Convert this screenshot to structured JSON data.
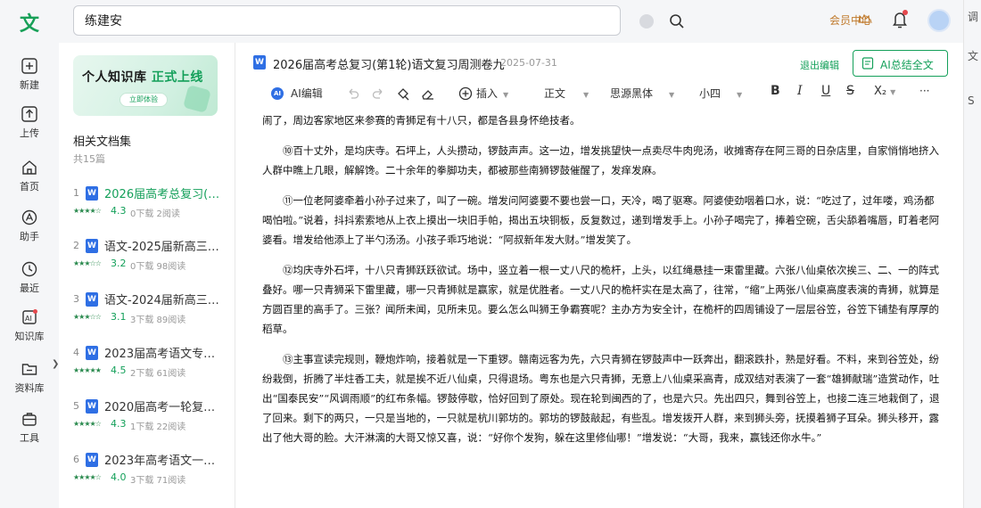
{
  "app": {
    "logo_char": "文"
  },
  "search": {
    "value": "练建安"
  },
  "header": {
    "member_center": "会员中心"
  },
  "nav": [
    {
      "label": "新建",
      "icon": "plus-icon"
    },
    {
      "label": "上传",
      "icon": "upload-icon"
    },
    {
      "label": "首页",
      "icon": "home-icon"
    },
    {
      "label": "助手",
      "icon": "assistant-icon"
    },
    {
      "label": "最近",
      "icon": "clock-icon"
    },
    {
      "label": "知识库",
      "icon": "ai-knowledge-icon"
    },
    {
      "label": "资料库",
      "icon": "folder-icon"
    },
    {
      "label": "工具",
      "icon": "toolbox-icon"
    }
  ],
  "banner": {
    "title_a": "个人知识库",
    "title_b": "正式上线",
    "button": "立即体验"
  },
  "sidebar": {
    "title": "相关文档集",
    "count": "共15篇",
    "docs": [
      {
        "num": "1",
        "name": "2026届高考总复习(…",
        "stars": "★★★★☆",
        "rating": "4.3",
        "meta": "0下载 2阅读"
      },
      {
        "num": "2",
        "name": "语文-2025届新高三…",
        "stars": "★★★☆☆",
        "rating": "3.2",
        "meta": "0下载 98阅读"
      },
      {
        "num": "3",
        "name": "语文-2024届新高三…",
        "stars": "★★★☆☆",
        "rating": "3.1",
        "meta": "3下载 89阅读"
      },
      {
        "num": "4",
        "name": "2023届高考语文专…",
        "stars": "★★★★★",
        "rating": "4.5",
        "meta": "2下载 61阅读"
      },
      {
        "num": "5",
        "name": "2020届高考一轮复…",
        "stars": "★★★★☆",
        "rating": "4.3",
        "meta": "1下载 22阅读"
      },
      {
        "num": "6",
        "name": "2023年高考语文一…",
        "stars": "★★★★☆",
        "rating": "4.0",
        "meta": "3下载 71阅读"
      }
    ]
  },
  "document": {
    "icon_char": "W",
    "title": "2026届高考总复习(第1轮)语文复习周测卷九",
    "date": "2025-07-31",
    "exit_edit": "退出编辑",
    "ai_summary": "AI总结全文"
  },
  "toolbar": {
    "ai_edit": "AI编辑",
    "insert": "插入",
    "style": "正文",
    "font": "思源黑体",
    "size": "小四",
    "bold": "B",
    "italic": "I",
    "underline": "U",
    "strike": "S",
    "sub": "X₂",
    "more": "···"
  },
  "content": {
    "p0": "闹了，周边客家地区来参赛的青狮足有十八只，都是各县身怀绝技者。",
    "p1": "⑩百十丈外，是均庆寺。石坪上，人头攒动，锣鼓声声。这一边，增发挑望快一点卖尽牛肉兜汤，收摊寄存在阿三哥的日杂店里，自家悄悄地挤入人群中瞧上几眼，解解馋。二十余年的拳脚功夫，都被那些南狮锣鼓催醒了，发痒发麻。",
    "p2": "⑪一位老阿婆牵着小孙子过来了，叫了一碗。增发问阿婆要不要也尝一口，天冷，喝了驱寒。阿婆使劲咽着口水，说：“吃过了，过年喽，鸡汤都喝怕啦。”说着，抖抖索索地从上衣上摸出一块旧手帕，揭出五块铜板，反复数过，递到增发手上。小孙子喝完了，捧着空碗，舌尖舔着嘴唇，盯着老阿婆看。增发给他添上了半勺汤汤。小孩子乖巧地说：“阿叔新年发大财。”增发笑了。",
    "p3": "⑫均庆寺外石坪，十八只青狮跃跃欲试。场中，竖立着一根一丈八尺的桅杆，上头，以红绳悬挂一束雷里藏。六张八仙桌依次挨三、二、一的阵式叠好。哪一只青狮采下雷里藏，哪一只青狮就是赢家，就是优胜者。一丈八尺的桅杆实在是太高了，往常，“缩”上两张八仙桌高度表演的青狮，就算是方圆百里的高手了。三张？闻所未闻，见所未见。要么怎么叫狮王争霸赛呢？主办方为安全计，在桅杆的四周铺设了一层层谷笠，谷笠下铺垫有厚厚的稻草。",
    "p4": "⑬主事宣读完规则，鞭炮炸响，接着就是一下重锣。赣南远客为先，六只青狮在锣鼓声中一跃奔出，翻滚跌扑，熟是好看。不料，来到谷笠处，纷纷栽倒，折腾了半炷香工夫，就是挨不近八仙桌，只得退场。粤东也是六只青狮，无意上八仙桌采高青，成双结对表演了一套“雄狮献瑞”造赏动作，吐出“国泰民安”“风调雨顺”的红布条幅。锣鼓停歇，恰好回到了原处。现在轮到闽西的了，也是六只。先出四只，舞到谷笠上，也接二连三地栽倒了，退了回来。剩下的两只，一只是当地的，一只就是杭川郭坊的。郭坊的锣鼓敲起，有些乱。增发拨开人群，来到狮头旁，抚摸着狮子耳朵。狮头移开，露出了他大哥的脸。大汗淋漓的大哥又惊又喜，说：“好你个发狗，躲在这里修仙哪！”增发说：“大哥，我来，赢钱还你水牛。”"
  },
  "right_strip": [
    "调",
    "文",
    "S"
  ]
}
